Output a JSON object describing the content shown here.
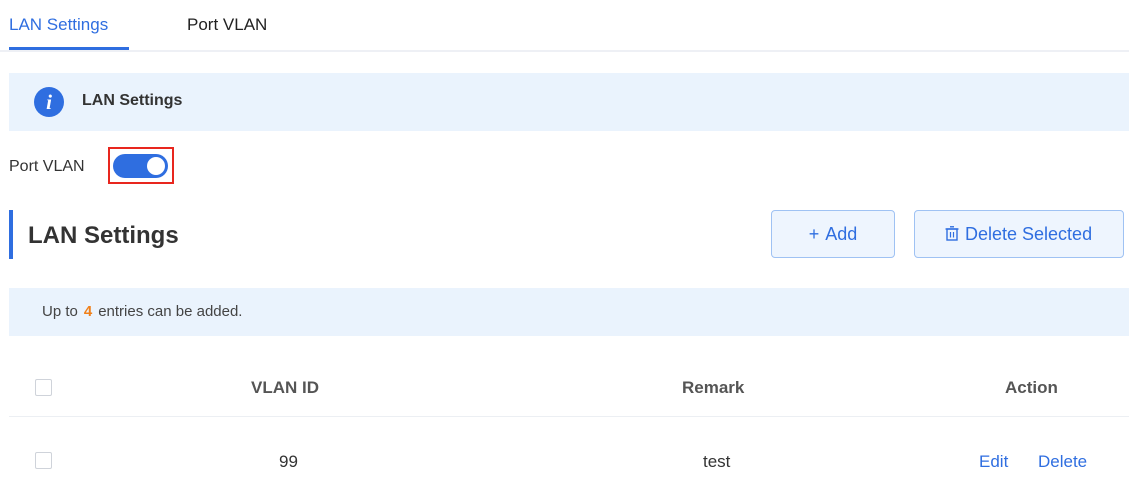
{
  "tabs": [
    {
      "label": "LAN Settings",
      "active": true
    },
    {
      "label": "Port VLAN",
      "active": false
    }
  ],
  "info_bar": {
    "icon": "info-icon",
    "title": "LAN Settings"
  },
  "port_vlan": {
    "label": "Port VLAN",
    "enabled": true
  },
  "section": {
    "title": "LAN Settings"
  },
  "toolbar": {
    "add_icon": "+",
    "add_label": "Add",
    "delete_icon": "trash-icon",
    "delete_label": "Delete Selected"
  },
  "limit": {
    "prefix": "Up to",
    "count": "4",
    "suffix": "entries can be added."
  },
  "table": {
    "columns": [
      "VLAN ID",
      "Remark",
      "Action"
    ],
    "rows": [
      {
        "vlan_id": "99",
        "remark": "test",
        "actions": [
          "Edit",
          "Delete"
        ]
      }
    ]
  },
  "colors": {
    "accent": "#2f6ee0",
    "highlight_border": "#e8261e",
    "count": "#f0801a",
    "info_bg": "#eaf3fd"
  }
}
